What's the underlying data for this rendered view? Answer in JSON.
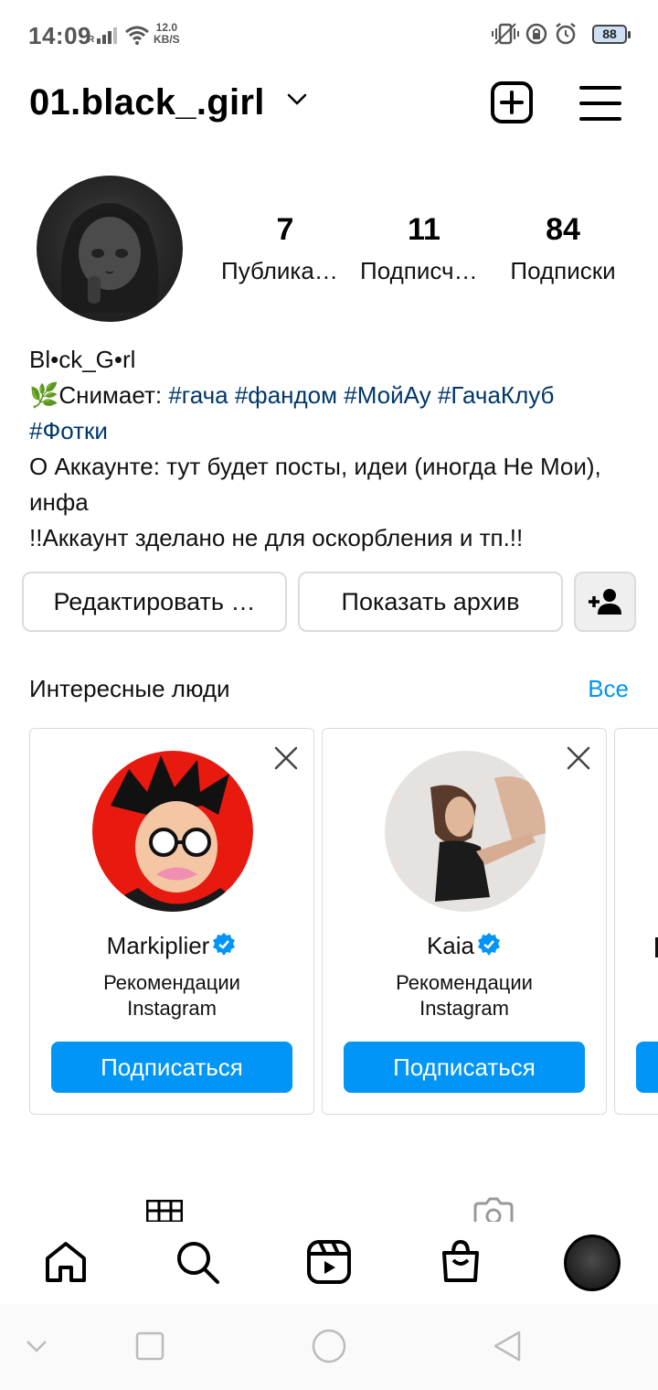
{
  "status_bar": {
    "time": "14:09",
    "net_speed_value": "12.0",
    "net_speed_unit": "KB/S",
    "battery": "88"
  },
  "header": {
    "username": "01.black_.girl"
  },
  "profile": {
    "stats": [
      {
        "value": "7",
        "label": "Публикации"
      },
      {
        "value": "11",
        "label": "Подписчики"
      },
      {
        "value": "84",
        "label": "Подписки"
      }
    ],
    "display_name": "Bl•ck_G•rl",
    "bio_prefix": "🌿Снимает: ",
    "hashtags": [
      "#гача",
      "#фандом",
      "#МойАу",
      "#ГачаКлуб",
      "#Фотки"
    ],
    "bio_line_about": "О Аккаунте: тут будет посты, идеи (иногда Не Мои), инфа",
    "bio_line_note": "!!Аккаунт зделано не для оскорбления и тп.!!"
  },
  "actions": {
    "edit_label": "Редактировать …",
    "archive_label": "Показать архив"
  },
  "suggestions": {
    "title": "Интересные люди",
    "see_all": "Все",
    "cards": [
      {
        "name": "Markiplier",
        "sub_line1": "Рекомендации",
        "sub_line2": "Instagram",
        "button": "Подписаться"
      },
      {
        "name": "Kaia",
        "sub_line1": "Рекомендации",
        "sub_line2": "Instagram",
        "button": "Подписаться"
      }
    ]
  },
  "colors": {
    "accent": "#0095f6",
    "hashtag": "#00376b",
    "border": "#dbdbdb"
  },
  "icons": {
    "header": [
      "new-post-icon",
      "menu-icon"
    ],
    "bottom_nav": [
      "home-icon",
      "search-icon",
      "reels-icon",
      "shop-icon",
      "profile-avatar"
    ],
    "system_nav": [
      "collapse-icon",
      "recents-icon",
      "home-circle-icon",
      "back-icon"
    ]
  }
}
